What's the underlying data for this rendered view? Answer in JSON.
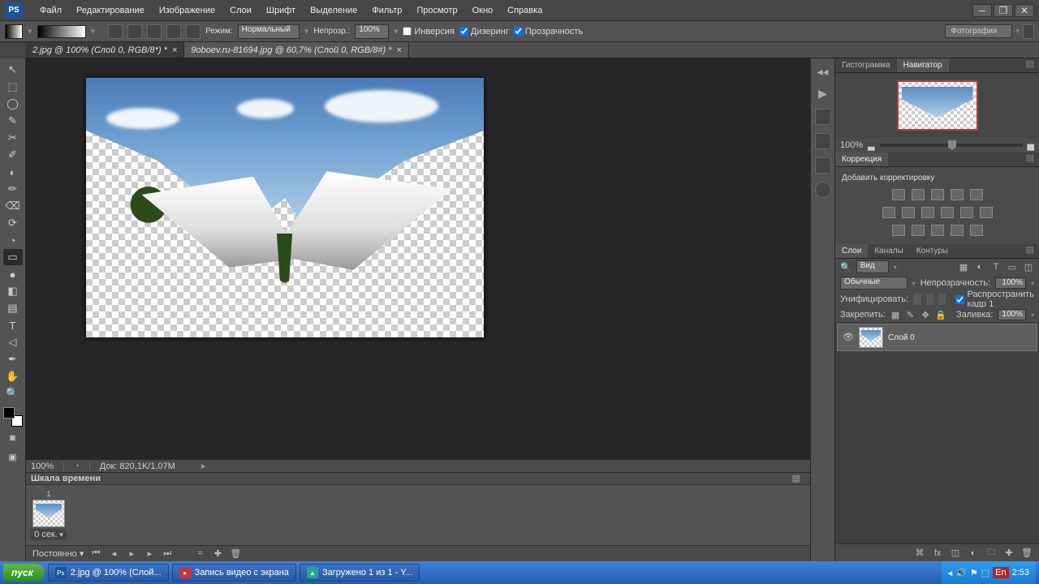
{
  "app": {
    "logo": "PS"
  },
  "menu": [
    "Файл",
    "Редактирование",
    "Изображение",
    "Слои",
    "Шрифт",
    "Выделение",
    "Фильтр",
    "Просмотр",
    "Окно",
    "Справка"
  ],
  "options": {
    "mode_label": "Режим:",
    "mode_value": "Нормальный",
    "opacity_label": "Непрозр.:",
    "opacity_value": "100%",
    "checks": {
      "inverse": "Инверсия",
      "dither": "Дизеринг",
      "transparency": "Прозрачность"
    },
    "workspace": "Фотография"
  },
  "tabs": [
    {
      "label": "2.jpg @ 100% (Слой 0, RGB/8*) *",
      "active": true
    },
    {
      "label": "9oboev.ru-81694.jpg @ 60,7% (Слой 0, RGB/8#) *",
      "active": false
    }
  ],
  "tools_list": [
    "↖",
    "⬚",
    "◯",
    "✎",
    "✂",
    "✐",
    "◐",
    "✏",
    "⌫",
    "⟳",
    "◔",
    "▭",
    "●",
    "◧",
    "▤",
    "✒",
    "T",
    "◁",
    "✋",
    "🔍"
  ],
  "status": {
    "zoom": "100%",
    "doc": "Док: 820,1K/1,07M"
  },
  "timeline": {
    "title": "Шкала времени",
    "frame_num": "1",
    "frame_time": "0 сек.",
    "loop": "Постоянно"
  },
  "nav_panel": {
    "tab_hist": "Гистограмма",
    "tab_nav": "Навигатор",
    "zoom": "100%"
  },
  "adj_panel": {
    "title": "Коррекция",
    "hint": "Добавить корректировку"
  },
  "layers_panel": {
    "tabs": [
      "Слои",
      "Каналы",
      "Контуры"
    ],
    "kind": "Вид",
    "blend": "Обычные",
    "opacity_label": "Непрозрачность:",
    "opacity": "100%",
    "unify_label": "Унифицировать:",
    "propagate": "Распространить кадр 1",
    "lock_label": "Закрепить:",
    "fill_label": "Заливка:",
    "fill": "100%",
    "layer0": "Слой 0"
  },
  "taskbar": {
    "start": "пуск",
    "items": [
      {
        "icon": "Ps",
        "label": "2.jpg @ 100% (Слой..."
      },
      {
        "icon": "●",
        "label": "Запись видео с экрана"
      },
      {
        "icon": "▲",
        "label": "Загружено 1 из 1 - Y..."
      }
    ],
    "lang": "En",
    "time": "2:53"
  }
}
